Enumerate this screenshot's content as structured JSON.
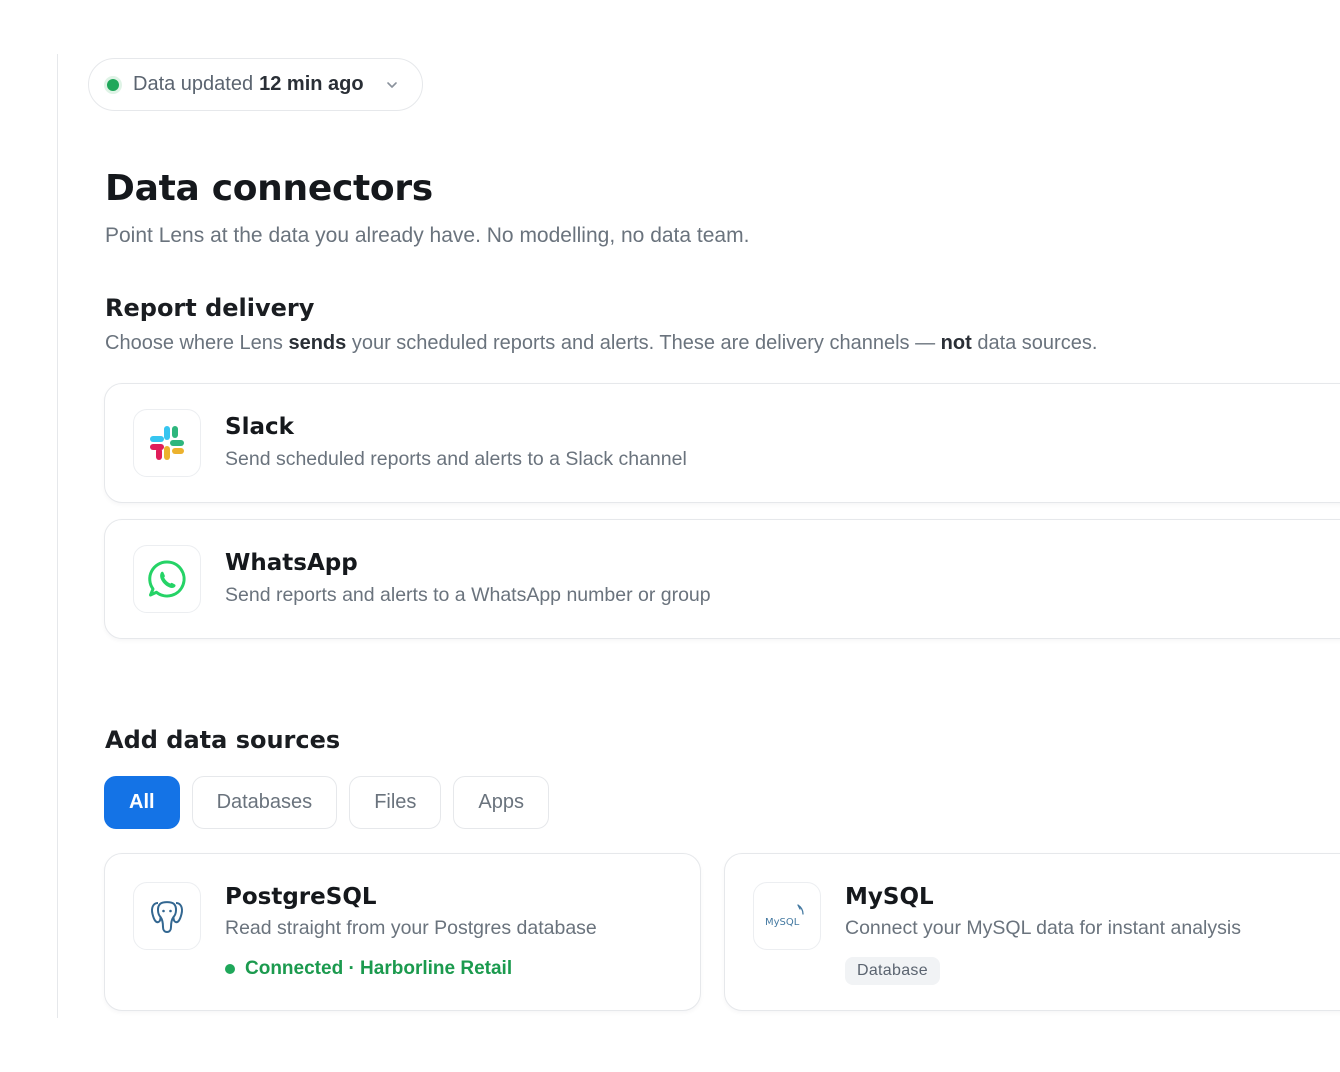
{
  "status": {
    "prefix": "Data updated",
    "strong": "12 min ago",
    "icon": "chevron-down-icon",
    "dot_color": "#1fa75a"
  },
  "page": {
    "title": "Data connectors",
    "subtitle": "Point Lens at the data you already have. No modelling, no data team."
  },
  "report_delivery": {
    "title": "Report delivery",
    "sub_part1": "Choose where Lens ",
    "sub_bold1": "sends",
    "sub_part2": " your scheduled reports and alerts. These are delivery channels — ",
    "sub_bold2": "not",
    "sub_part3": " data sources.",
    "channels": [
      {
        "name": "Slack",
        "description": "Send scheduled reports and alerts to a Slack channel",
        "icon": "slack-icon"
      },
      {
        "name": "WhatsApp",
        "description": "Send reports and alerts to a WhatsApp number or group",
        "icon": "whatsapp-icon"
      }
    ]
  },
  "data_sources": {
    "title": "Add data sources",
    "tabs": [
      {
        "label": "All",
        "active": true
      },
      {
        "label": "Databases",
        "active": false
      },
      {
        "label": "Files",
        "active": false
      },
      {
        "label": "Apps",
        "active": false
      }
    ],
    "sources": [
      {
        "name": "PostgreSQL",
        "description": "Read straight from your Postgres database",
        "status": "Connected · Harborline Retail",
        "icon": "postgresql-icon"
      },
      {
        "name": "MySQL",
        "description": "Connect your MySQL data for instant analysis",
        "badge": "Database",
        "icon": "mysql-icon",
        "logo_text": "MySQL"
      }
    ]
  },
  "colors": {
    "accent": "#1473e6",
    "connected": "#1b9a4e"
  }
}
